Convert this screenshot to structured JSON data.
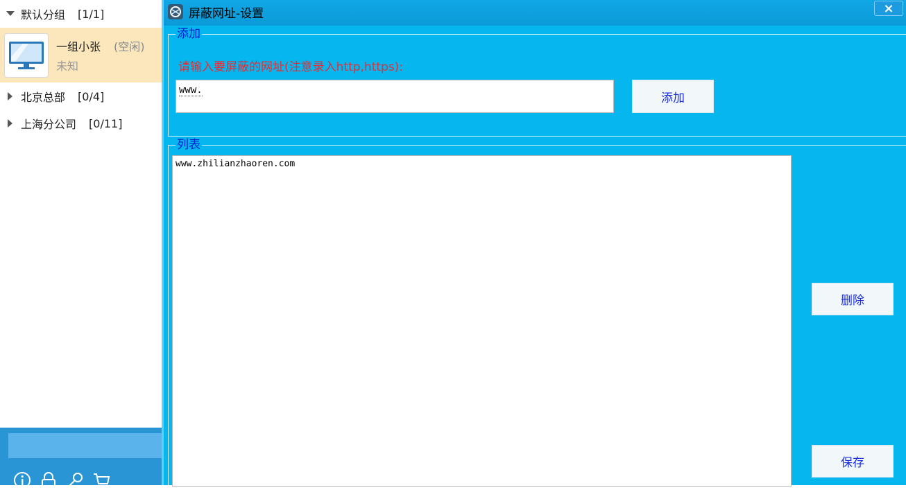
{
  "sidebar": {
    "groups": [
      {
        "name": "默认分组",
        "count": "[1/1]",
        "expanded": true
      },
      {
        "name": "北京总部",
        "count": "[0/4]",
        "expanded": false
      },
      {
        "name": "上海分公司",
        "count": "[0/11]",
        "expanded": false
      }
    ],
    "member": {
      "name": "一组小张",
      "status": "(空闲)",
      "location": "未知"
    }
  },
  "dialog": {
    "title": "屏蔽网址-设置",
    "close_label": "×",
    "add_section": {
      "legend": "添加",
      "prompt": "请输入要屏蔽的网址(注意录入http,https):",
      "input_value": "www.",
      "add_button": "添加"
    },
    "list_section": {
      "legend": "列表",
      "items": [
        "www.zhilianzhaoren.com"
      ],
      "delete_button": "删除",
      "save_button": "保存"
    }
  },
  "colors": {
    "dialog_bg": "#05b6ef",
    "selected_row": "#fbe7bb",
    "prompt_red": "#e62f34",
    "legend_blue": "#0022cc"
  }
}
